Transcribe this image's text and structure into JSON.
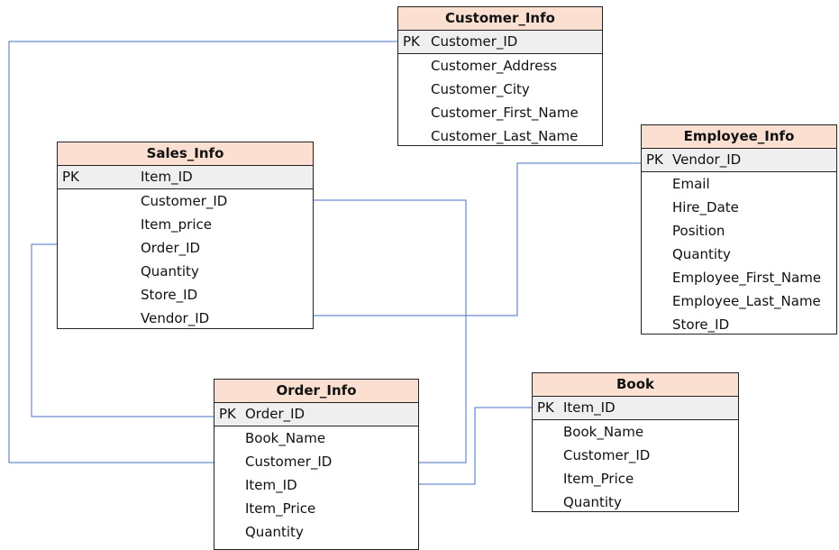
{
  "tables": {
    "customer_info": {
      "title": "Customer_Info",
      "pk_label": "PK",
      "pk": "Customer_ID",
      "fields": [
        "Customer_Address",
        "Customer_City",
        "Customer_First_Name",
        "Customer_Last_Name"
      ]
    },
    "sales_info": {
      "title": "Sales_Info",
      "pk_label": "PK",
      "pk": "Item_ID",
      "fields": [
        "Customer_ID",
        "Item_price",
        "Order_ID",
        "Quantity",
        "Store_ID",
        "Vendor_ID"
      ]
    },
    "employee_info": {
      "title": "Employee_Info",
      "pk_label": "PK",
      "pk": "Vendor_ID",
      "fields": [
        "Email",
        "Hire_Date",
        "Position",
        "Quantity",
        "Employee_First_Name",
        "Employee_Last_Name",
        "Store_ID"
      ]
    },
    "order_info": {
      "title": "Order_Info",
      "pk_label": "PK",
      "pk": "Order_ID",
      "fields": [
        "Book_Name",
        "Customer_ID",
        "Item_ID",
        "Item_Price",
        "Quantity"
      ]
    },
    "book": {
      "title": "Book",
      "pk_label": "PK",
      "pk": "Item_ID",
      "fields": [
        "Book_Name",
        "Customer_ID",
        "Item_Price",
        "Quantity"
      ]
    }
  },
  "line_color": "#4472c4"
}
